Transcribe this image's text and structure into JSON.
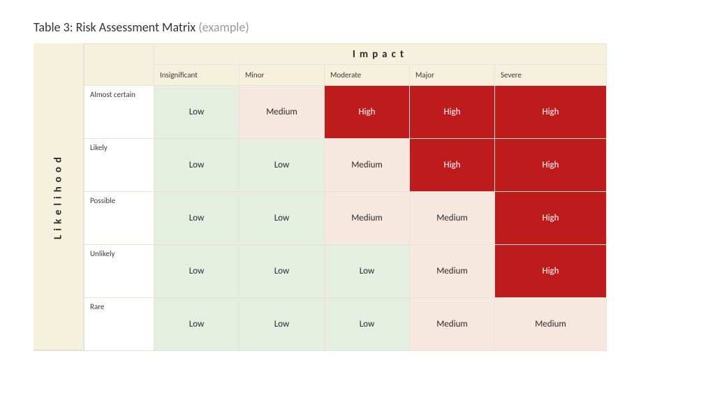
{
  "title": {
    "main": "Table 3: Risk Assessment Matrix ",
    "muted": "(example)"
  },
  "axes": {
    "impact_label": "Impact",
    "likelihood_label": "Likelihood"
  },
  "impact_levels": [
    "Insignificant",
    "Minor",
    "Moderate",
    "Major",
    "Severe"
  ],
  "likelihood_levels": [
    "Almost certain",
    "Likely",
    "Possible",
    "Unlikely",
    "Rare"
  ],
  "risk_labels": {
    "low": "Low",
    "medium": "Medium",
    "high": "High"
  },
  "matrix": [
    [
      "low",
      "medium",
      "high",
      "high",
      "high"
    ],
    [
      "low",
      "low",
      "medium",
      "high",
      "high"
    ],
    [
      "low",
      "low",
      "medium",
      "medium",
      "high"
    ],
    [
      "low",
      "low",
      "low",
      "medium",
      "high"
    ],
    [
      "low",
      "low",
      "low",
      "medium",
      "medium"
    ]
  ],
  "chart_data": {
    "type": "table",
    "title": "Table 3: Risk Assessment Matrix (example)",
    "x_axis": "Impact",
    "y_axis": "Likelihood",
    "columns": [
      "Insignificant",
      "Minor",
      "Moderate",
      "Major",
      "Severe"
    ],
    "rows": [
      "Almost certain",
      "Likely",
      "Possible",
      "Unlikely",
      "Rare"
    ],
    "cells": [
      [
        "Low",
        "Medium",
        "High",
        "High",
        "High"
      ],
      [
        "Low",
        "Low",
        "Medium",
        "High",
        "High"
      ],
      [
        "Low",
        "Low",
        "Medium",
        "Medium",
        "High"
      ],
      [
        "Low",
        "Low",
        "Low",
        "Medium",
        "High"
      ],
      [
        "Low",
        "Low",
        "Low",
        "Medium",
        "Medium"
      ]
    ],
    "legend": {
      "Low": "#e4eee1",
      "Medium": "#f7e8df",
      "High": "#be1c1c"
    }
  }
}
